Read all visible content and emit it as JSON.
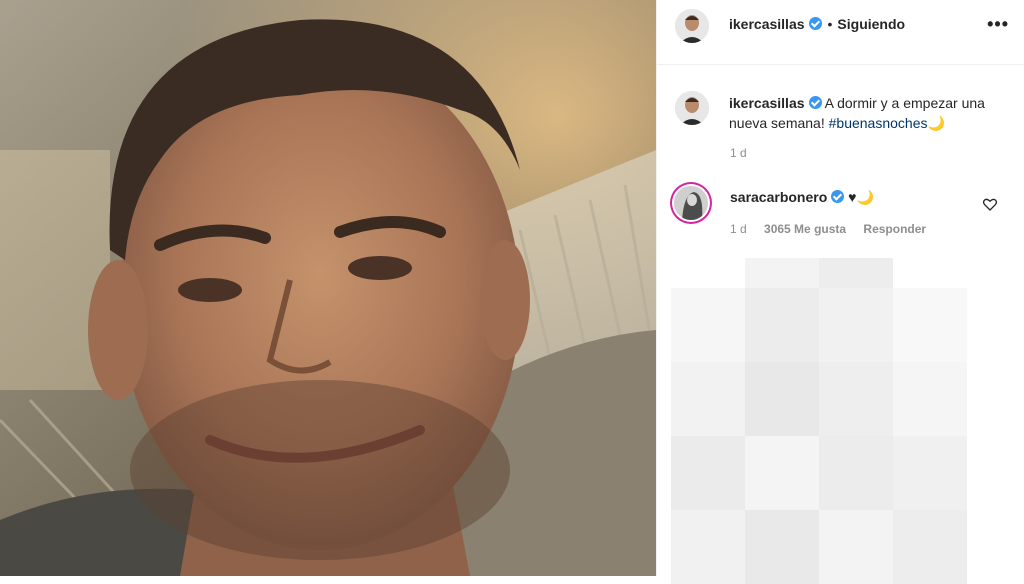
{
  "post": {
    "author": "ikercasillas",
    "follow_status": "Siguiendo",
    "more_icon": "more-options-icon",
    "caption_text": "A dormir y a empezar una nueva semana!",
    "caption_hashtag": "#buenasnoches",
    "caption_emoji": "🌙",
    "time": "1 d"
  },
  "comment": {
    "author": "saracarbonero",
    "text": "♥",
    "emoji": "🌙",
    "time": "1 d",
    "likes": "3065 Me gusta",
    "reply": "Responder"
  },
  "colors": {
    "verified": "#3897f0",
    "hashtag": "#00376b",
    "muted": "#8e8e8e",
    "text": "#262626"
  }
}
